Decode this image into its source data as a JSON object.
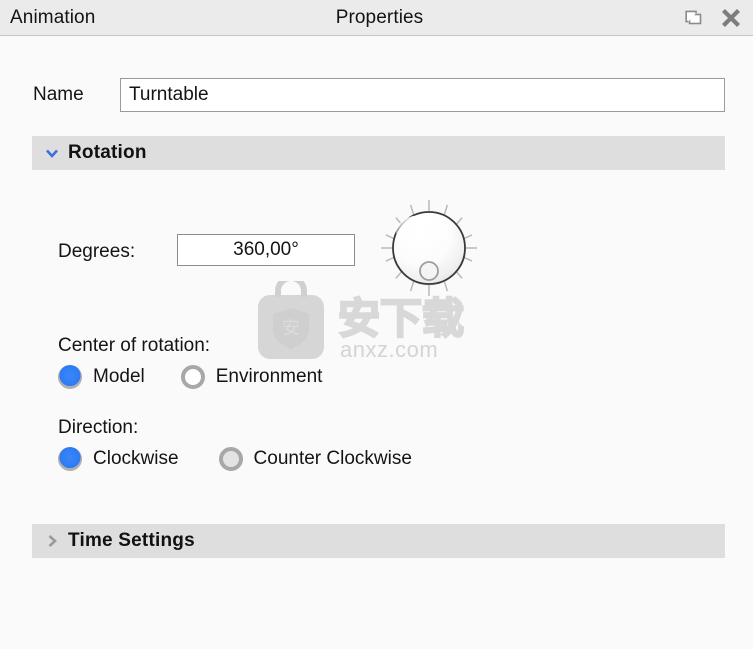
{
  "titlebar": {
    "tab_label": "Animation",
    "panel_title": "Properties",
    "undock_icon": "undock-icon",
    "close_icon": "close-icon",
    "bg_color": "#ebebeb"
  },
  "name_row": {
    "label": "Name",
    "value": "Turntable",
    "placeholder": "Name"
  },
  "sections": [
    {
      "id": "rotation",
      "title": "Rotation",
      "expanded": true,
      "chevron": "chevron-down-icon",
      "chevron_color": "#3b6fe0"
    },
    {
      "id": "time_settings",
      "title": "Time Settings",
      "expanded": false,
      "chevron": "chevron-right-icon",
      "chevron_color": "#9a9a9a"
    }
  ],
  "rotation": {
    "degrees": {
      "label": "Degrees:",
      "value": "360,00°",
      "placeholder": "0,00°"
    },
    "dial": {
      "name": "rotation-dial",
      "indicator_angle_deg": 180,
      "tick_count": 16
    },
    "center_of_rotation": {
      "label": "Center of rotation:",
      "options": [
        {
          "label": "Model",
          "selected": true
        },
        {
          "label": "Environment",
          "selected": false
        }
      ]
    },
    "direction": {
      "label": "Direction:",
      "options": [
        {
          "label": "Clockwise",
          "selected": true
        },
        {
          "label": "Counter Clockwise",
          "selected": false
        }
      ]
    }
  },
  "watermark": {
    "cn_text": "安下载",
    "domain_text": "anxz.com",
    "badge_char": "安"
  },
  "colors": {
    "accent": "#2d7bf5",
    "section_header_bg": "#dedede",
    "page_bg": "#fafafa",
    "text": "#141414"
  }
}
